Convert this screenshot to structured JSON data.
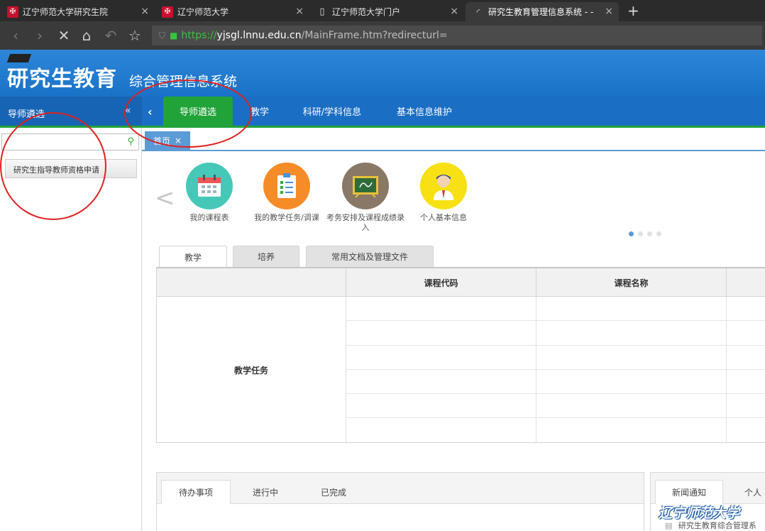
{
  "browser": {
    "tabs": [
      {
        "title": "辽宁师范大学研究生院",
        "icon": "university-logo-icon"
      },
      {
        "title": "辽宁师范大学",
        "icon": "university-logo-icon"
      },
      {
        "title": "辽宁师范大学门户",
        "icon": "document-icon"
      },
      {
        "title": "研究生教育管理信息系统 - -",
        "icon": "loading-icon",
        "active": true
      }
    ],
    "url": {
      "scheme": "https://",
      "host": "yjsgl.lnnu.edu.cn",
      "path": "/MainFrame.htm?redirecturl="
    }
  },
  "app": {
    "logo_main": "研究生教育",
    "logo_sub": "综合管理信息系统",
    "brand_color": "#1a6ec4",
    "accent_color": "#22a33a"
  },
  "menu": {
    "items": [
      {
        "label": "导师遴选",
        "active": true
      },
      {
        "label": "教学"
      },
      {
        "label": "科研/学科信息"
      },
      {
        "label": "基本信息维护"
      }
    ]
  },
  "sidebar": {
    "title": "导师遴选",
    "collapse": "«",
    "search_placeholder": "",
    "items": [
      {
        "label": "研究生指导教师资格申请"
      }
    ]
  },
  "page_tabs": [
    {
      "label": "首页",
      "close": "×"
    }
  ],
  "quick_access": [
    {
      "label": "我的课程表",
      "icon": "calendar-icon",
      "color": "#45c8b8"
    },
    {
      "label": "我的教学任务/调课",
      "icon": "checklist-icon",
      "color": "#f58c28"
    },
    {
      "label": "考务安排及课程成绩录入",
      "icon": "blackboard-icon",
      "color": "#8a7867"
    },
    {
      "label": "个人基本信息",
      "icon": "person-icon",
      "color": "#f7e114"
    }
  ],
  "carousel": {
    "dots": 4,
    "active_dot": 1
  },
  "subtabs": [
    {
      "label": "教学",
      "active": true
    },
    {
      "label": "培养"
    },
    {
      "label": "常用文档及管理文件"
    }
  ],
  "teaching_table": {
    "columns": [
      "",
      "课程代码",
      "课程名称",
      ""
    ],
    "row_label": "教学任务",
    "rows": 6
  },
  "todo_tabs": [
    {
      "label": "待办事项",
      "active": true
    },
    {
      "label": "进行中"
    },
    {
      "label": "已完成"
    }
  ],
  "news_tabs": [
    {
      "label": "新闻通知",
      "active": true
    },
    {
      "label": "个人"
    }
  ],
  "news_items": [
    "研究生教育综合管理系"
  ],
  "watermark": "辽宁师范大学"
}
